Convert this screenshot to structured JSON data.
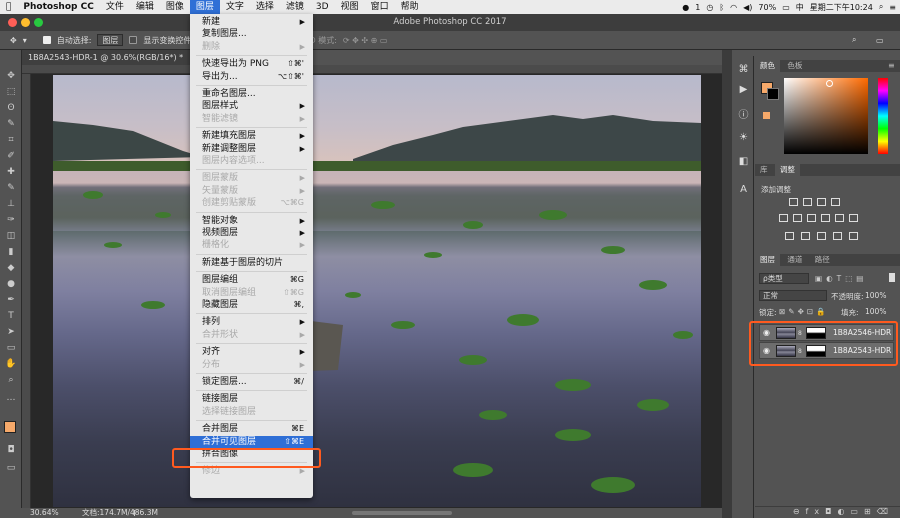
{
  "menubar": {
    "app": "Photoshop CC",
    "items": [
      "文件",
      "编辑",
      "图像",
      "图层",
      "文字",
      "选择",
      "滤镜",
      "3D",
      "视图",
      "窗口",
      "帮助"
    ],
    "active_index": 3,
    "status": {
      "notify": "1",
      "battery": "70%",
      "datetime": "星期二下午10:24"
    }
  },
  "window": {
    "title": "Adobe Photoshop CC 2017"
  },
  "options": {
    "auto_select_label": "自动选择:",
    "auto_select_value": "图层",
    "show_transform_label": "显示变换控件",
    "mode_3d_label": "3D 模式:"
  },
  "document": {
    "tab": "1B8A2543-HDR-1 @ 30.6%(RGB/16*) *",
    "zoom": "30.64%",
    "doc_info": "文档:174.7M/486.3M"
  },
  "layer_menu": {
    "items": [
      {
        "label": "新建",
        "submenu": true,
        "disabled": false
      },
      {
        "label": "复制图层...",
        "disabled": false
      },
      {
        "label": "删除",
        "submenu": true,
        "disabled": true
      },
      {
        "sep": true
      },
      {
        "label": "快速导出为 PNG",
        "shortcut": "⇧⌘'",
        "disabled": false
      },
      {
        "label": "导出为...",
        "shortcut": "⌥⇧⌘'",
        "disabled": false
      },
      {
        "sep": true
      },
      {
        "label": "重命名图层...",
        "disabled": false
      },
      {
        "label": "图层样式",
        "submenu": true,
        "disabled": false
      },
      {
        "label": "智能滤镜",
        "submenu": true,
        "disabled": true
      },
      {
        "sep": true
      },
      {
        "label": "新建填充图层",
        "submenu": true,
        "disabled": false
      },
      {
        "label": "新建调整图层",
        "submenu": true,
        "disabled": false
      },
      {
        "label": "图层内容选项...",
        "disabled": true
      },
      {
        "sep": true
      },
      {
        "label": "图层蒙版",
        "submenu": true,
        "disabled": true
      },
      {
        "label": "矢量蒙版",
        "submenu": true,
        "disabled": true
      },
      {
        "label": "创建剪贴蒙版",
        "shortcut": "⌥⌘G",
        "disabled": true
      },
      {
        "sep": true
      },
      {
        "label": "智能对象",
        "submenu": true,
        "disabled": false
      },
      {
        "label": "视频图层",
        "submenu": true,
        "disabled": false
      },
      {
        "label": "栅格化",
        "submenu": true,
        "disabled": true
      },
      {
        "sep": true
      },
      {
        "label": "新建基于图层的切片",
        "disabled": false
      },
      {
        "sep": true
      },
      {
        "label": "图层编组",
        "shortcut": "⌘G",
        "disabled": false
      },
      {
        "label": "取消图层编组",
        "shortcut": "⇧⌘G",
        "disabled": true
      },
      {
        "label": "隐藏图层",
        "shortcut": "⌘,",
        "disabled": false
      },
      {
        "sep": true
      },
      {
        "label": "排列",
        "submenu": true,
        "disabled": false
      },
      {
        "label": "合并形状",
        "submenu": true,
        "disabled": true
      },
      {
        "sep": true
      },
      {
        "label": "对齐",
        "submenu": true,
        "disabled": false
      },
      {
        "label": "分布",
        "submenu": true,
        "disabled": true
      },
      {
        "sep": true
      },
      {
        "label": "锁定图层...",
        "shortcut": "⌘/",
        "disabled": false
      },
      {
        "sep": true
      },
      {
        "label": "链接图层",
        "disabled": false
      },
      {
        "label": "选择链接图层",
        "disabled": true
      },
      {
        "sep": true
      },
      {
        "label": "合并图层",
        "shortcut": "⌘E",
        "disabled": false
      },
      {
        "label": "合并可见图层",
        "shortcut": "⇧⌘E",
        "disabled": false,
        "highlighted": true
      },
      {
        "label": "拼合图像",
        "disabled": false
      },
      {
        "sep": true
      },
      {
        "label": "修边",
        "submenu": true,
        "disabled": true
      }
    ]
  },
  "color_panel": {
    "tabs": [
      "颜色",
      "色板"
    ],
    "foreground": "#f6a96a",
    "background": "#000000"
  },
  "adjust_panel": {
    "tabs": [
      "库",
      "调整"
    ],
    "add_label": "添加调整"
  },
  "layers_panel": {
    "tabs": [
      "图层",
      "通道",
      "路径"
    ],
    "filter_label": "ρ类型",
    "blend_mode": "正常",
    "opacity_label": "不透明度:",
    "opacity_value": "100%",
    "lock_label": "锁定:",
    "fill_label": "填充:",
    "fill_value": "100%",
    "layers": [
      {
        "name": "1B8A2546-HDR"
      },
      {
        "name": "1B8A2543-HDR"
      }
    ]
  },
  "colors": {
    "highlight_box": "#ff5a1f",
    "menu_highlight": "#2f6fd6"
  }
}
